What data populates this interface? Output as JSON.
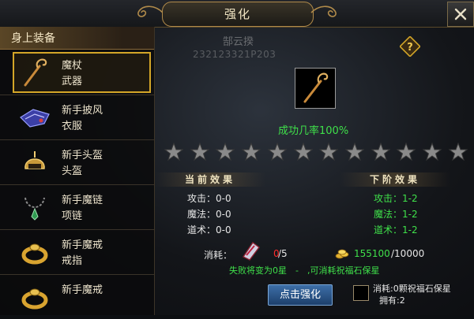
{
  "window": {
    "title": "强化"
  },
  "left_panel": {
    "header": "身上装备",
    "items": [
      {
        "name": "魔杖",
        "type": "武器",
        "selected": true,
        "icon": "staff-icon"
      },
      {
        "name": "新手披风",
        "type": "衣服",
        "selected": false,
        "icon": "cloak-icon"
      },
      {
        "name": "新手头盔",
        "type": "头盔",
        "selected": false,
        "icon": "helmet-icon"
      },
      {
        "name": "新手魔链",
        "type": "项链",
        "selected": false,
        "icon": "necklace-icon"
      },
      {
        "name": "新手魔戒",
        "type": "戒指",
        "selected": false,
        "icon": "ring-icon"
      },
      {
        "name": "新手魔戒",
        "type": "",
        "selected": false,
        "icon": "ring-icon"
      }
    ]
  },
  "player": {
    "name": "郜云揆",
    "id": "232123321P203"
  },
  "target": {
    "icon": "staff-icon",
    "success_rate": "成功几率100%"
  },
  "stars": {
    "total": 12,
    "filled": 0
  },
  "current": {
    "title": "当前效果",
    "stats": [
      "攻击：0-0",
      "魔法：0-0",
      "道术：0-0"
    ]
  },
  "next": {
    "title": "下阶效果",
    "stats": [
      "攻击：1-2",
      "魔法：1-2",
      "道术：1-2"
    ]
  },
  "cost": {
    "label": "消耗：",
    "stone_have": "0",
    "stone_need": "/5",
    "gold_have": "155100",
    "gold_need": "/10000"
  },
  "fail_note": "失败将变为0星　-　,可消耗祝福石保星",
  "enhance_button": "点击强化",
  "bless": {
    "line1": "消耗:0颗祝福石保星",
    "line2": "拥有:2"
  },
  "colors": {
    "accent_gold": "#d4a628",
    "success_green": "#3fe04a",
    "warn_red": "#ff2b2b",
    "button_blue": "#2d5a8e"
  }
}
